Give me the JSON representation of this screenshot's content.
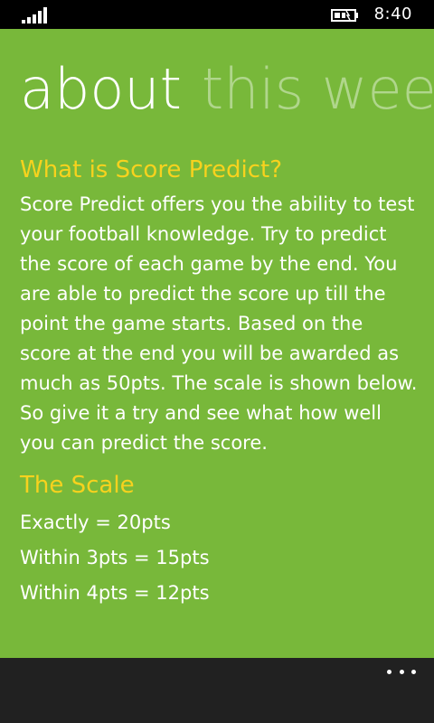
{
  "status_bar": {
    "signal_icon": "signal-strength-icon",
    "battery_icon": "battery-charging-icon",
    "time": "8:40"
  },
  "pivot": {
    "active_title": "about",
    "next_title": "this wee"
  },
  "about": {
    "title": "What is Score Predict?",
    "description": "Score Predict offers you the ability to test your football knowledge. Try to predict the score of each game by the end. You are able to predict the score up till the point the game starts. Based on the score at the end you will be awarded as much as 50pts. The scale is shown below. So give it a try and see what how well you can predict the score."
  },
  "scale": {
    "title": "The Scale",
    "items": [
      "Exactly = 20pts",
      "Within 3pts = 15pts",
      "Within 4pts = 12pts"
    ]
  },
  "app_bar": {
    "more_icon": "ellipsis-icon"
  },
  "colors": {
    "background": "#78b83a",
    "accent": "#f7d21e",
    "text": "#ffffff",
    "app_bar": "#212121"
  }
}
